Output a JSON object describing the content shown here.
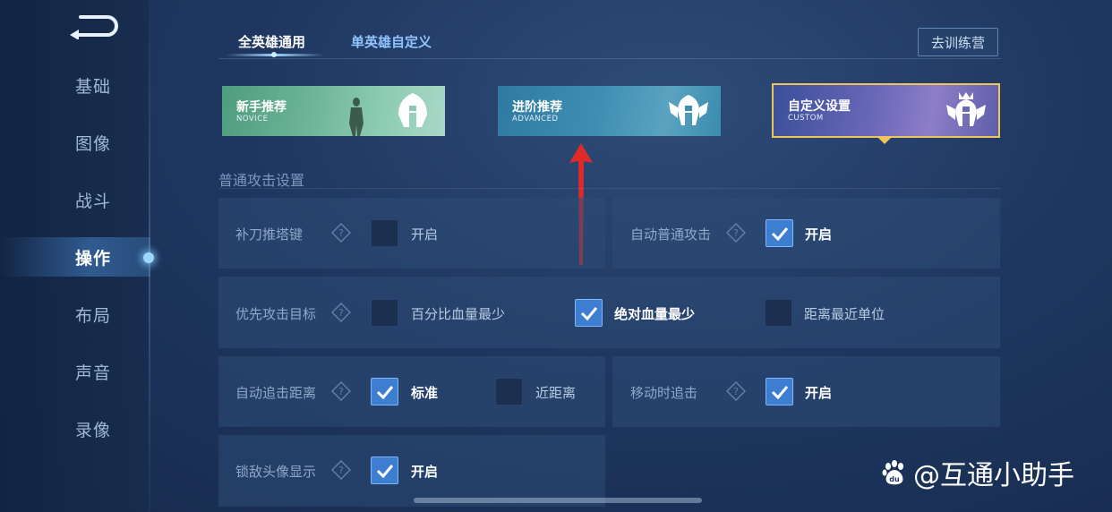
{
  "sidebar": {
    "items": [
      {
        "label": "基础"
      },
      {
        "label": "图像"
      },
      {
        "label": "战斗"
      },
      {
        "label": "操作"
      },
      {
        "label": "布局"
      },
      {
        "label": "声音"
      },
      {
        "label": "录像"
      }
    ],
    "active_index": 3
  },
  "tabs": [
    {
      "label": "全英雄通用",
      "active": true
    },
    {
      "label": "单英雄自定义",
      "active": false
    }
  ],
  "training_button": "去训练营",
  "presets": [
    {
      "title": "新手推荐",
      "subtitle": "NOVICE",
      "selected": false
    },
    {
      "title": "进阶推荐",
      "subtitle": "ADVANCED",
      "selected": false
    },
    {
      "title": "自定义设置",
      "subtitle": "CUSTOM",
      "selected": true
    }
  ],
  "section_title": "普通攻击设置",
  "settings": {
    "last_hit": {
      "label": "补刀推塔键",
      "option": "开启",
      "checked": false
    },
    "auto_attack": {
      "label": "自动普通攻击",
      "option": "开启",
      "checked": true
    },
    "priority": {
      "label": "优先攻击目标",
      "options": [
        {
          "label": "百分比血量最少",
          "checked": false
        },
        {
          "label": "绝对血量最少",
          "checked": true
        },
        {
          "label": "距离最近单位",
          "checked": false
        }
      ]
    },
    "chase_distance": {
      "label": "自动追击距离",
      "options": [
        {
          "label": "标准",
          "checked": true
        },
        {
          "label": "近距离",
          "checked": false
        }
      ]
    },
    "move_chase": {
      "label": "移动时追击",
      "option": "开启",
      "checked": true
    },
    "lock_portrait": {
      "label": "锁敌头像显示",
      "option": "开启",
      "checked": true
    }
  },
  "watermark": "@互通小助手",
  "colors": {
    "accent": "#3d7ed0",
    "selected_border": "#f0c45c",
    "arrow": "#e02a2a"
  }
}
